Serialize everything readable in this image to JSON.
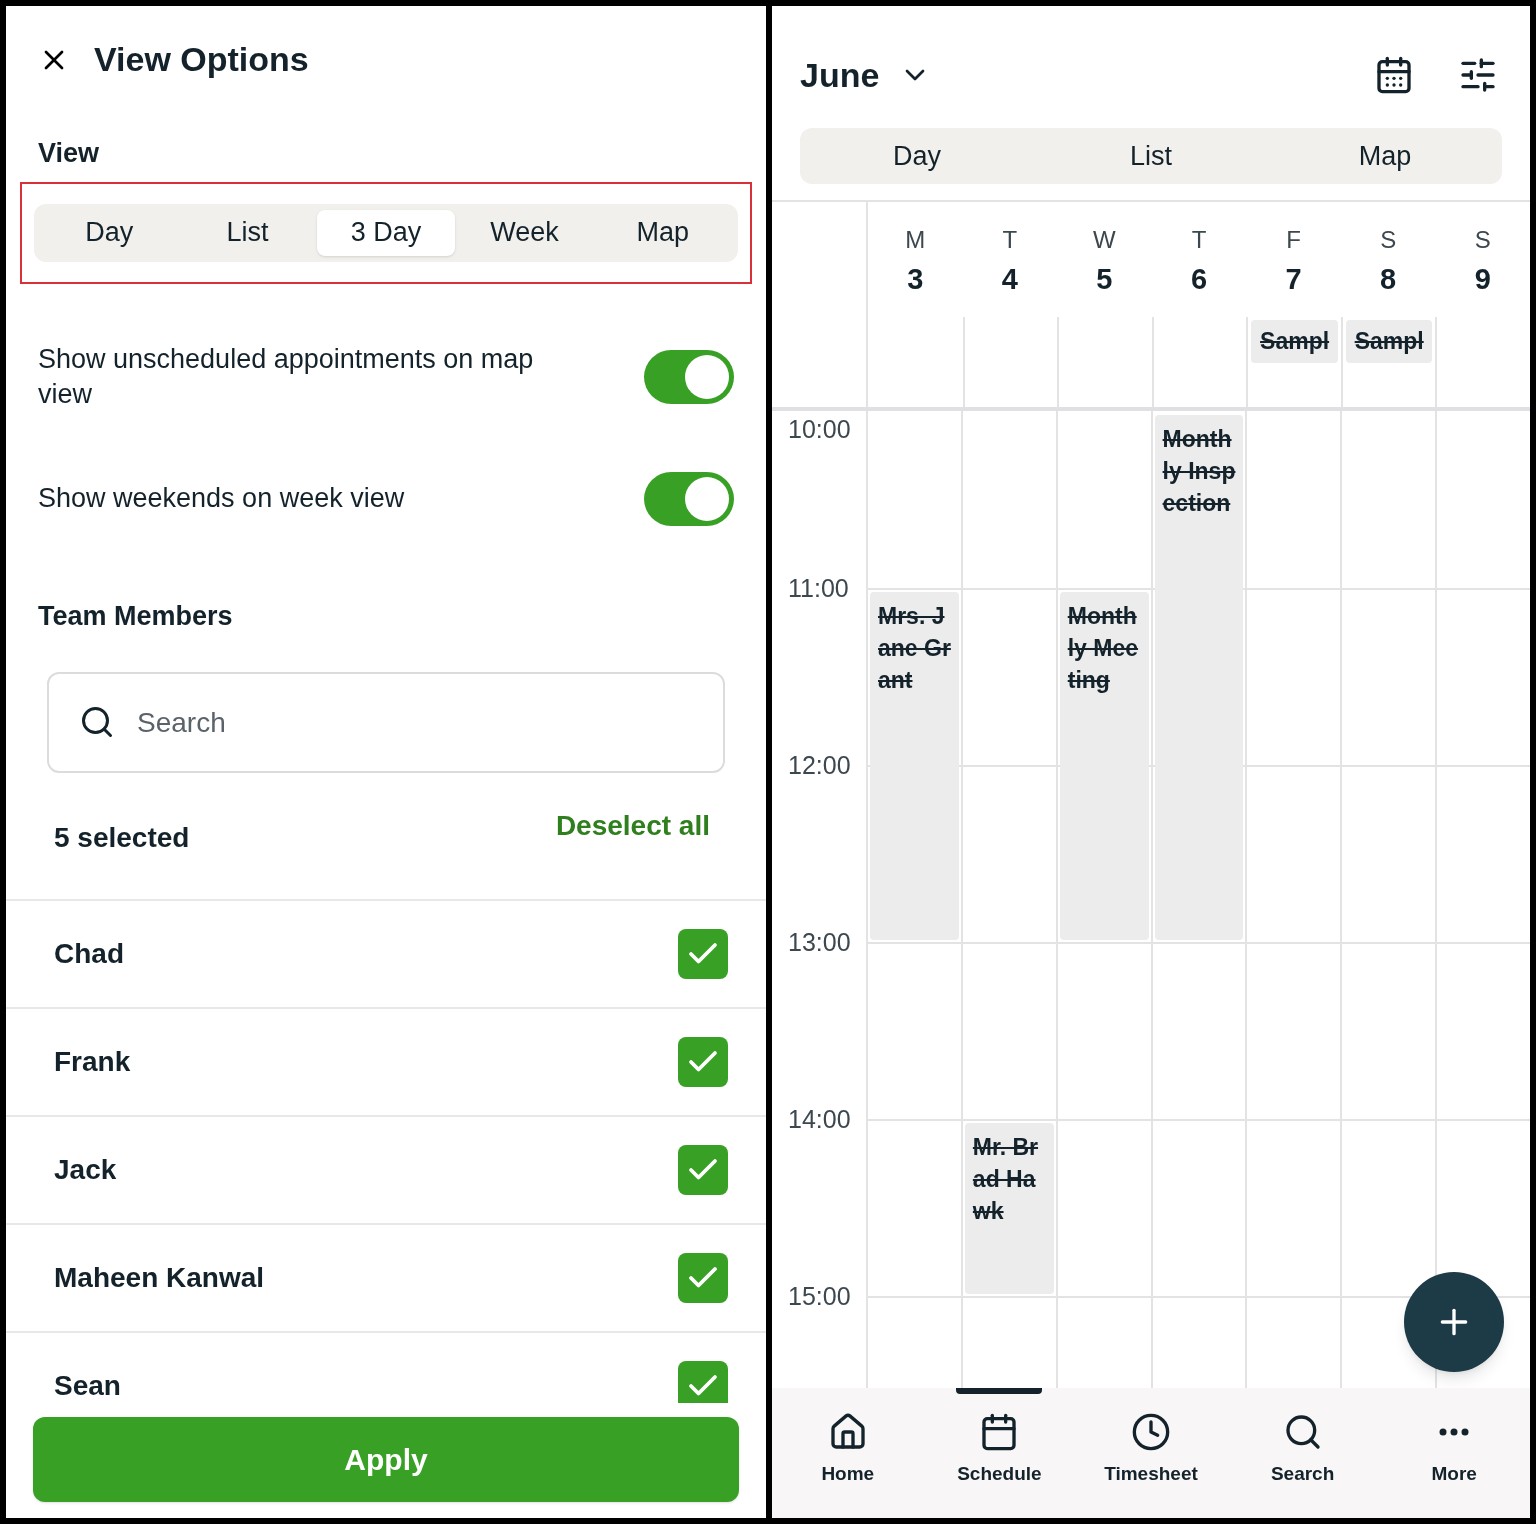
{
  "left": {
    "title": "View Options",
    "view_label": "View",
    "view_tabs": [
      {
        "label": "Day",
        "selected": false
      },
      {
        "label": "List",
        "selected": false
      },
      {
        "label": "3 Day",
        "selected": true
      },
      {
        "label": "Week",
        "selected": false
      },
      {
        "label": "Map",
        "selected": false
      }
    ],
    "toggles": [
      {
        "label": "Show unscheduled appointments on map view",
        "on": true
      },
      {
        "label": "Show weekends on week view",
        "on": true
      }
    ],
    "team_heading": "Team Members",
    "search": {
      "placeholder": "Search"
    },
    "selected_count": "5 selected",
    "deselect_all": "Deselect all",
    "members": [
      {
        "name": "Chad",
        "checked": true
      },
      {
        "name": "Frank",
        "checked": true
      },
      {
        "name": "Jack",
        "checked": true
      },
      {
        "name": "Maheen Kanwal",
        "checked": true
      },
      {
        "name": "Sean",
        "checked": true
      }
    ],
    "apply": "Apply"
  },
  "right": {
    "month": "June",
    "view_tabs": [
      {
        "label": "Day",
        "selected": false
      },
      {
        "label": "List",
        "selected": false
      },
      {
        "label": "Map",
        "selected": false
      }
    ],
    "days": [
      {
        "weekday": "M",
        "date": "3",
        "events": [
          {
            "title": "Mrs. Jane Grant"
          }
        ]
      },
      {
        "weekday": "T",
        "date": "4",
        "events": [
          {
            "title": "Mr. Brad Hawk"
          }
        ]
      },
      {
        "weekday": "W",
        "date": "5",
        "events": [
          {
            "title": "Monthly Meeting"
          }
        ]
      },
      {
        "weekday": "T",
        "date": "6",
        "events": [
          {
            "title": "Monthly Inspection"
          }
        ]
      },
      {
        "weekday": "F",
        "date": "7",
        "all_day": [
          "Sampl"
        ]
      },
      {
        "weekday": "S",
        "date": "8",
        "all_day": [
          "Sampl"
        ]
      },
      {
        "weekday": "S",
        "date": "9"
      }
    ],
    "hours": [
      "10:00",
      "11:00",
      "12:00",
      "13:00",
      "14:00",
      "15:00"
    ],
    "nav": [
      {
        "label": "Home",
        "selected": false
      },
      {
        "label": "Schedule",
        "selected": true
      },
      {
        "label": "Timesheet",
        "selected": false
      },
      {
        "label": "Search",
        "selected": false
      },
      {
        "label": "More",
        "selected": false
      }
    ]
  }
}
